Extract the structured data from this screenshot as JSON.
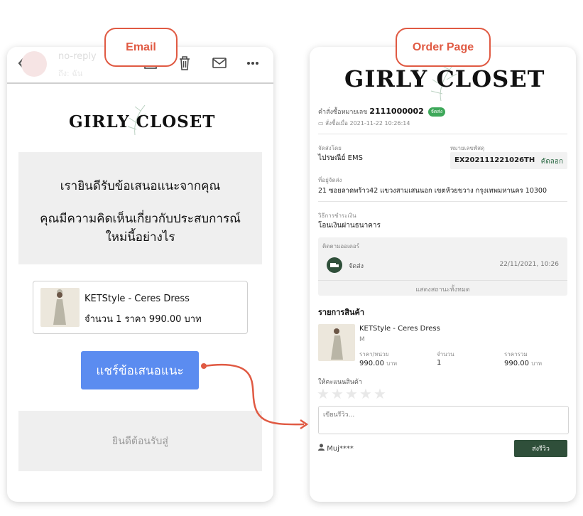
{
  "callouts": {
    "email": "Email",
    "order": "Order Page"
  },
  "email": {
    "sender_name": "no-reply",
    "sender_sub": "ถึง: ฉัน",
    "brand": "GIRLY CLOSET",
    "thanks_heading": "เรายินดีรับข้อเสนอแนะจากคุณ",
    "question_line1": "คุณมีความคิดเห็นเกี่ยวกับประสบการณ์",
    "question_line2": "ใหม่นี้อย่างไร",
    "product_name": "KETStyle - Ceres Dress",
    "product_qty_price": "จำนวน 1 ราคา 990.00 บาท",
    "share_button": "แชร์ข้อเสนอแนะ",
    "welcome_text": "ยินดีต้อนรับสู่"
  },
  "order": {
    "brand": "GIRLY CLOSET",
    "order_label": "คำสั่งซื้อหมายเลข",
    "order_number": "2111000002",
    "status_badge": "จัดส่ง",
    "order_date": "สั่งซื้อเมื่อ 2021-11-22 10:26:14",
    "shipped_by_label": "จัดส่งโดย",
    "shipped_by": "ไปรษณีย์ EMS",
    "tracking_label": "หมายเลขพัสดุ",
    "tracking_number": "EX202111221026TH",
    "copy_label": "คัดลอก",
    "address_label": "ที่อยู่จัดส่ง",
    "address": "21 ซอยลาดพร้าว42 แขวงสามเสนนอก เขตห้วยขวาง กรุงเทพมหานคร 10300",
    "payment_label": "วิธีการชำระเงิน",
    "payment": "โอนเงินผ่านธนาคาร",
    "track_label": "ติดตามออเดอร์",
    "track_status": "จัดส่ง",
    "track_time": "22/11/2021, 10:26",
    "show_all_status": "แสดงสถานะทั้งหมด",
    "items_heading": "รายการสินค้า",
    "item_name": "KETStyle - Ceres Dress",
    "item_variant": "M",
    "unit_price_label": "ราคา/หน่วย",
    "unit_price": "990.00",
    "currency": "บาท",
    "qty_label": "จำนวน",
    "qty": "1",
    "total_label": "ราคารวม",
    "total": "990.00",
    "rate_label": "ให้คะแนนสินค้า",
    "rating": 0,
    "review_placeholder": "เขียนรีวิว...",
    "reviewer": "Muj****",
    "submit_review": "ส่งรีวิว"
  },
  "colors": {
    "callout": "#e05a43",
    "share_button": "#5b8cf0",
    "submit_button": "#2f4f3a",
    "status_green": "#3ea85a"
  }
}
